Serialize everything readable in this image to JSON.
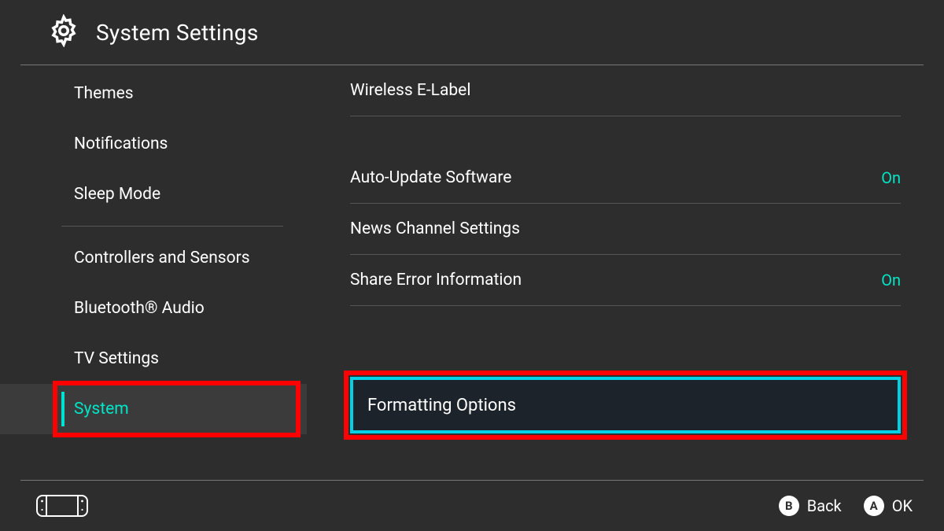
{
  "header": {
    "title": "System Settings"
  },
  "sidebar": {
    "items_top": [
      {
        "label": "Themes"
      },
      {
        "label": "Notifications"
      },
      {
        "label": "Sleep Mode"
      }
    ],
    "items_bottom": [
      {
        "label": "Controllers and Sensors"
      },
      {
        "label": "Bluetooth® Audio"
      },
      {
        "label": "TV Settings"
      },
      {
        "label": "System"
      }
    ],
    "selected": "System"
  },
  "main": {
    "rows": {
      "wireless_e_label": "Wireless E-Label",
      "auto_update": {
        "label": "Auto-Update Software",
        "value": "On"
      },
      "news_channel": "News Channel Settings",
      "share_error": {
        "label": "Share Error Information",
        "value": "On"
      },
      "formatting_options": "Formatting Options"
    }
  },
  "footer": {
    "back": {
      "button": "B",
      "label": "Back"
    },
    "ok": {
      "button": "A",
      "label": "OK"
    }
  },
  "highlight_color": "#ff0000"
}
